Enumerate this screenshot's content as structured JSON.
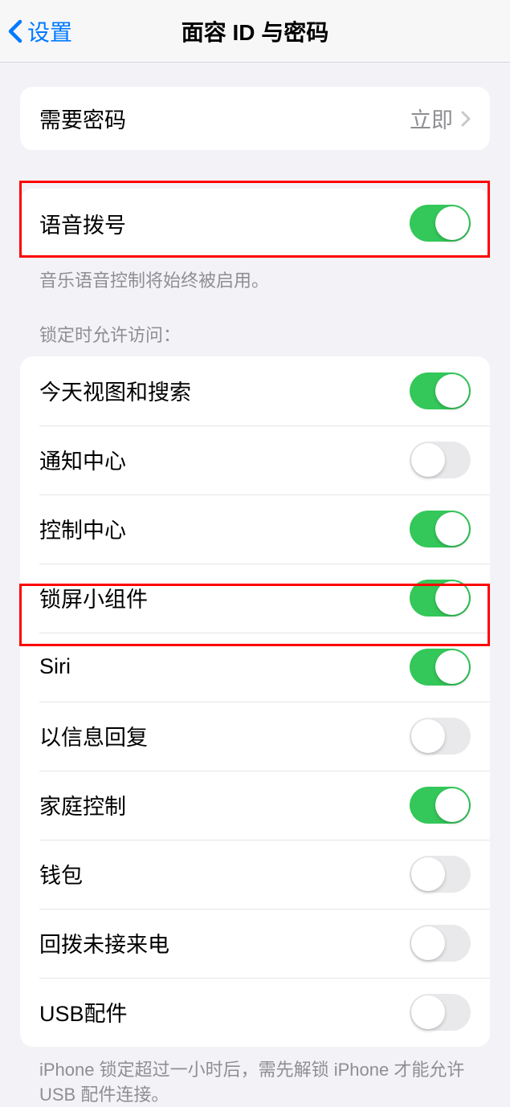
{
  "header": {
    "back_label": "设置",
    "title": "面容 ID 与密码"
  },
  "passcode_row": {
    "label": "需要密码",
    "value": "立即"
  },
  "voice_dial": {
    "label": "语音拨号",
    "on": true
  },
  "voice_dial_footer": "音乐语音控制将始终被启用。",
  "lock_section_header": "锁定时允许访问：",
  "lock_items": [
    {
      "label": "今天视图和搜索",
      "on": true
    },
    {
      "label": "通知中心",
      "on": false
    },
    {
      "label": "控制中心",
      "on": true
    },
    {
      "label": "锁屏小组件",
      "on": true
    },
    {
      "label": "Siri",
      "on": true
    },
    {
      "label": "以信息回复",
      "on": false
    },
    {
      "label": "家庭控制",
      "on": true
    },
    {
      "label": "钱包",
      "on": false
    },
    {
      "label": "回拨未接来电",
      "on": false
    },
    {
      "label": "USB配件",
      "on": false
    }
  ],
  "usb_footer": "iPhone 锁定超过一小时后，需先解锁 iPhone 才能允许 USB 配件连接。"
}
